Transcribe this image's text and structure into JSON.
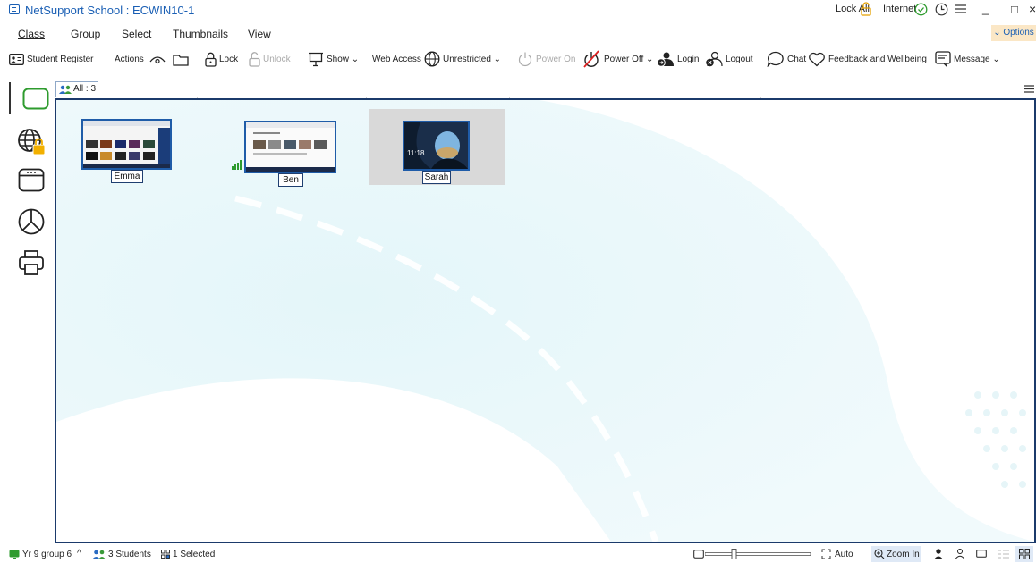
{
  "window": {
    "title": "NetSupport School : ECWIN10-1"
  },
  "titlebar": {
    "lock_all": "Lock All",
    "internet": "Internet",
    "minimize": "_",
    "maximize": "□",
    "close": "×"
  },
  "menu": {
    "items": [
      "Class",
      "Group",
      "Select",
      "Thumbnails",
      "View"
    ],
    "options": "⌄ Options"
  },
  "toolbar": {
    "student_register": "Student Register",
    "actions": "Actions",
    "lock": "Lock",
    "unlock": "Unlock",
    "show": "Show ⌄",
    "web_access": "Web Access",
    "unrestricted": "Unrestricted ⌄",
    "power_on": "Power On",
    "power_off": "Power Off ⌄",
    "login": "Login",
    "logout": "Logout",
    "chat": "Chat",
    "feedback": "Feedback and Wellbeing",
    "message": "Message ⌄"
  },
  "workspace": {
    "all_tab": "All : 3",
    "students": [
      {
        "name": "Emma",
        "screen": "browser-dark"
      },
      {
        "name": "Ben",
        "screen": "browser-light"
      },
      {
        "name": "Sarah",
        "screen": "lockscreen",
        "time": "11:18",
        "selected": true
      }
    ]
  },
  "statusbar": {
    "group": "Yr 9 group 6",
    "students": "3 Students",
    "selected": "1 Selected",
    "auto": "Auto",
    "zoom_in": "Zoom In"
  },
  "colors": {
    "accent": "#1a5fb4",
    "canvas_border": "#1b3a6b",
    "options_bg": "#fbe7c6",
    "green": "#2e9b2e"
  }
}
